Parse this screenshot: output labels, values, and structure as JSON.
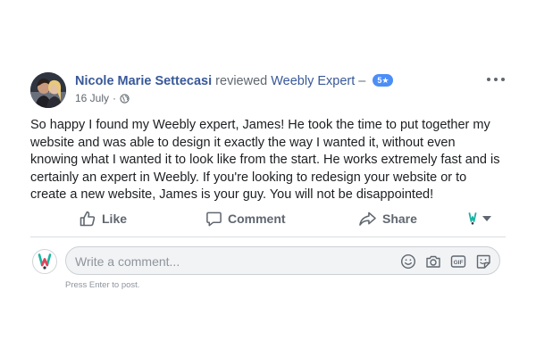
{
  "post": {
    "author": "Nicole Marie Settecasi",
    "action_text": "reviewed",
    "page_name": "Weebly Expert",
    "separator": "–",
    "rating": "5★",
    "date": "16 July",
    "meta_dot": "·",
    "privacy_icon": "globe-icon",
    "menu_icon": "more-options-icon",
    "body": "So happy I found my Weebly expert, James! He took the time to put together my website and was able to design it exactly the way I wanted it, without even knowing what I wanted it to look like from the start. He works extremely fast and is certainly an expert in Weebly. If you're looking to redesign your website or to create a new website, James is your guy. You will not be disappointed!"
  },
  "actions": {
    "like_label": "Like",
    "comment_label": "Comment",
    "share_label": "Share",
    "like_icon": "thumbs-up-icon",
    "comment_icon": "speech-bubble-icon",
    "share_icon": "share-arrow-icon",
    "audience_icon": "weebly-logo-icon"
  },
  "composer": {
    "placeholder": "Write a comment...",
    "hint": "Press Enter to post.",
    "tools": [
      "emoji-icon",
      "camera-icon",
      "gif-icon",
      "sticker-icon"
    ]
  },
  "colors": {
    "link": "#385898",
    "muted": "#606770",
    "badge": "#4c8ef7",
    "divider": "#dadde1",
    "composer_bg": "#f2f3f5"
  }
}
